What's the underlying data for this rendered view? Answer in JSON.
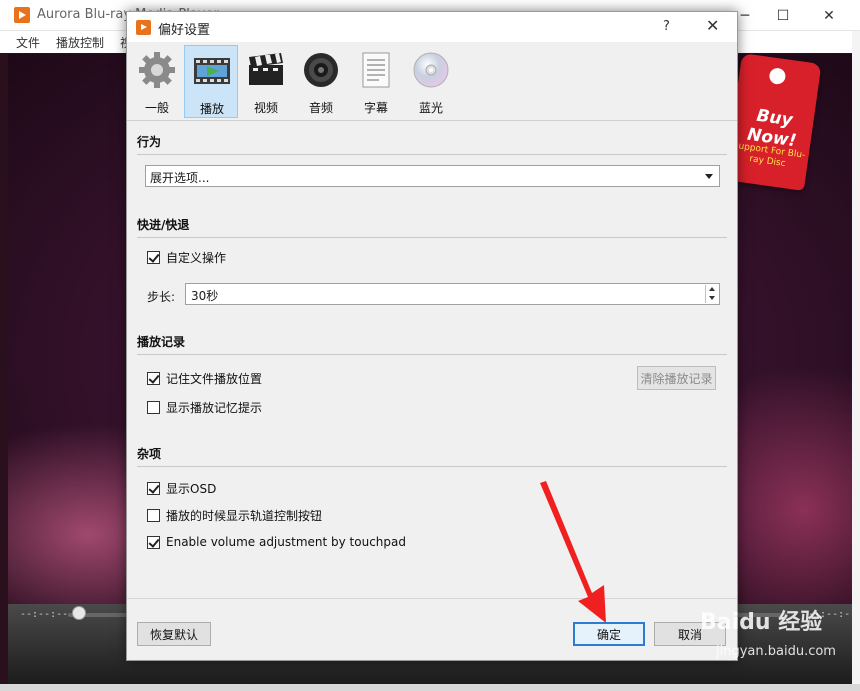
{
  "app": {
    "title": "Aurora Blu-ray Media Player",
    "menu": [
      "文件",
      "播放控制",
      "视"
    ],
    "controls": {
      "minimize": "─",
      "maximize": "☐",
      "close": "✕"
    },
    "time_left": "--:--:--",
    "time_right": "--:--:--",
    "promo": {
      "title": "Buy Now!",
      "subtitle": "Support For Blu-ray Disc"
    }
  },
  "dialog": {
    "title": "偏好设置",
    "help": "?",
    "close": "✕",
    "tabs": [
      {
        "label": "一般",
        "icon": "gear-icon",
        "selected": false
      },
      {
        "label": "播放",
        "icon": "film-play-icon",
        "selected": true
      },
      {
        "label": "视频",
        "icon": "clapperboard-icon",
        "selected": false
      },
      {
        "label": "音频",
        "icon": "speaker-icon",
        "selected": false
      },
      {
        "label": "字幕",
        "icon": "document-icon",
        "selected": false
      },
      {
        "label": "蓝光",
        "icon": "disc-icon",
        "selected": false
      }
    ],
    "sections": {
      "behavior": {
        "heading": "行为",
        "combo_value": "展开选项..."
      },
      "seek": {
        "heading": "快进/快退",
        "custom_label": "自定义操作",
        "custom_checked": true,
        "step_label": "步长:",
        "step_value": "30秒"
      },
      "history": {
        "heading": "播放记录",
        "remember_label": "记住文件播放位置",
        "remember_checked": true,
        "show_hint_label": "显示播放记忆提示",
        "show_hint_checked": false,
        "clear_button": "清除播放记录"
      },
      "misc": {
        "heading": "杂项",
        "osd_label": "显示OSD",
        "osd_checked": true,
        "track_label": "播放的时候显示轨道控制按钮",
        "track_checked": false,
        "touchpad_label": "Enable volume adjustment by touchpad",
        "touchpad_checked": true
      }
    },
    "buttons": {
      "reset": "恢复默认",
      "ok": "确定",
      "cancel": "取消"
    }
  },
  "watermark": {
    "logo": "Baidu 经验",
    "url": "jingyan.baidu.com"
  },
  "colors": {
    "accent": "#2b7cd3",
    "arrow": "#f02020",
    "selected_tab": "#cce4f7"
  }
}
